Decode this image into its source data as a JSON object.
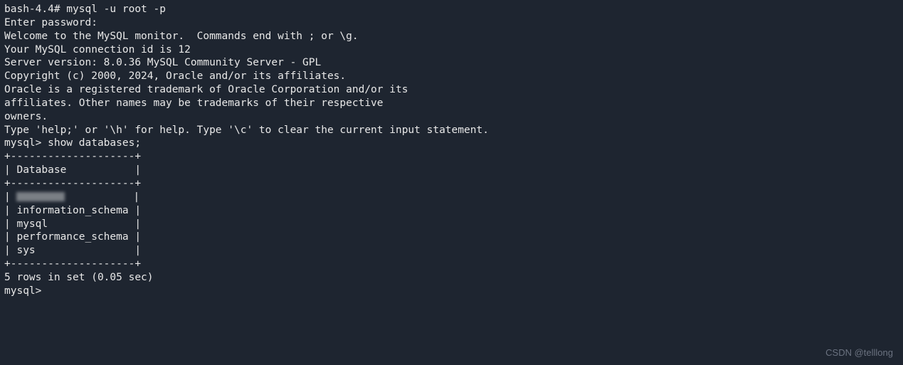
{
  "terminal": {
    "lines": [
      "bash-4.4# mysql -u root -p",
      "Enter password:",
      "Welcome to the MySQL monitor.  Commands end with ; or \\g.",
      "Your MySQL connection id is 12",
      "Server version: 8.0.36 MySQL Community Server - GPL",
      "",
      "Copyright (c) 2000, 2024, Oracle and/or its affiliates.",
      "",
      "Oracle is a registered trademark of Oracle Corporation and/or its",
      "affiliates. Other names may be trademarks of their respective",
      "owners.",
      "",
      "Type 'help;' or '\\h' for help. Type '\\c' to clear the current input statement.",
      "",
      "mysql> show databases;",
      "+--------------------+",
      "| Database           |",
      "+--------------------+"
    ],
    "blurred_row": {
      "prefix": "| ",
      "suffix": "           |"
    },
    "databases": [
      "| information_schema |",
      "| mysql              |",
      "| performance_schema |",
      "| sys                |"
    ],
    "footer_lines": [
      "+--------------------+",
      "5 rows in set (0.05 sec)",
      "",
      "mysql>"
    ]
  },
  "watermark": "CSDN @telllong"
}
